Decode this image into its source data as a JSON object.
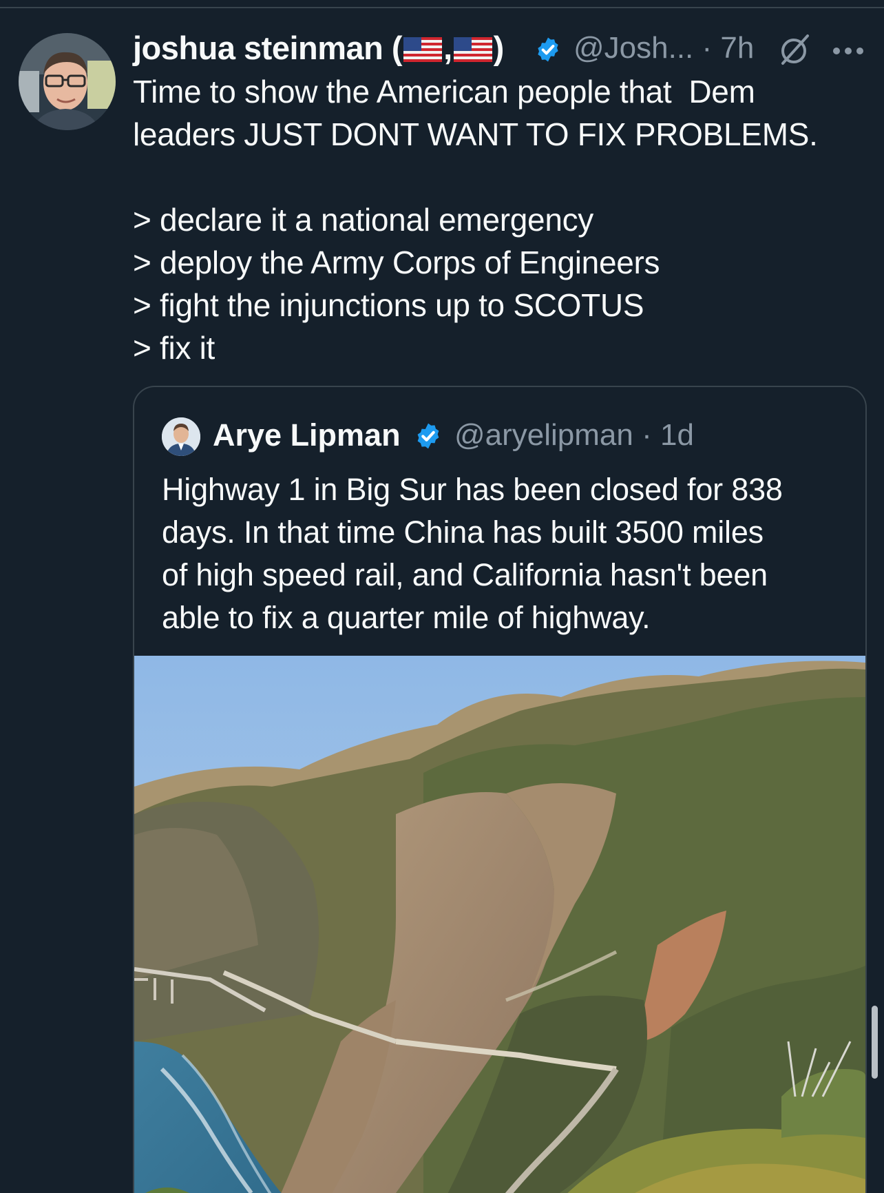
{
  "tweet": {
    "display_name_prefix": "joshua steinman (",
    "display_name_comma": ",",
    "display_name_suffix": ")",
    "flags": [
      "us-flag",
      "us-flag"
    ],
    "handle": "@Josh...",
    "separator": "·",
    "time": "7h",
    "text_lines": [
      "Time to show the American people that  Dem",
      "leaders JUST DONT WANT TO FIX PROBLEMS.",
      "",
      "> declare it a national emergency",
      "> deploy the Army Corps of Engineers",
      "> fight the injunctions up to SCOTUS",
      "> fix it"
    ],
    "icons": {
      "verified": "verified-badge-icon",
      "grok": "grok-icon",
      "more": "more-options-icon"
    }
  },
  "quote": {
    "display_name": "Arye Lipman",
    "handle": "@aryelipman",
    "separator": "·",
    "time": "1d",
    "text_lines": [
      "Highway 1 in Big Sur has been closed for 838",
      "days. In that time China has built 3500 miles",
      "of high speed rail, and California hasn't been",
      "able to fix a quarter mile of highway."
    ],
    "image_alt": "Photo of a landslide across coastal mountains over a highway in Big Sur"
  },
  "colors": {
    "background": "#15202b",
    "text": "#f7f9f9",
    "secondary_text": "#8b98a5",
    "border": "#38444d",
    "verified_blue": "#1d9bf0"
  }
}
